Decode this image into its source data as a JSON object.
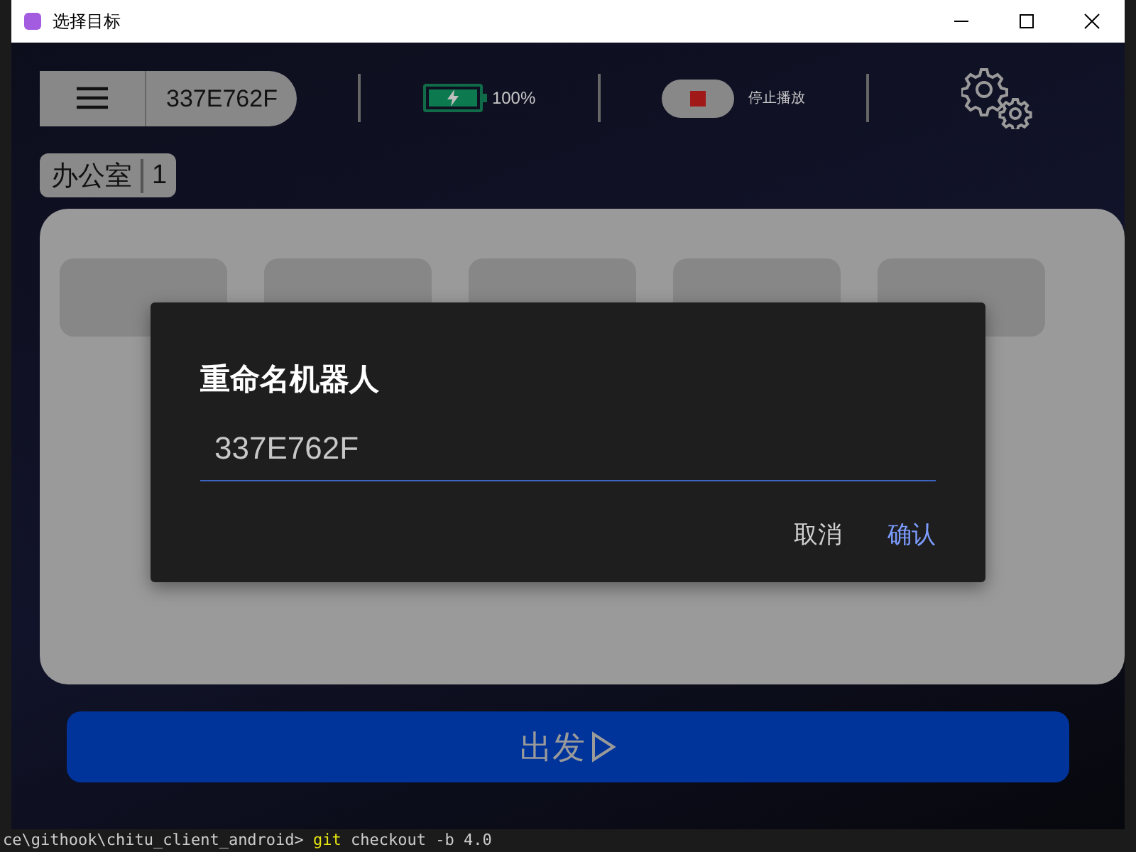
{
  "window": {
    "title": "选择目标"
  },
  "header": {
    "robot_name": "337E762F",
    "battery": {
      "level": 1,
      "reading": "100%",
      "charging": true
    },
    "stop_button": {
      "label": "停止播放"
    }
  },
  "current_location": {
    "name": "办公室",
    "count": "1"
  },
  "dialog": {
    "title": "重命名机器人",
    "value": "337E762F",
    "buttons": [
      {
        "label": "取消",
        "kind": "secondary"
      },
      {
        "label": "确认",
        "kind": "primary"
      }
    ]
  },
  "go_button": {
    "label": "出发"
  },
  "terminal": {
    "prompt": "ce\\githook\\chitu_client_android>",
    "command": "git",
    "args": "checkout -b 4.0"
  }
}
